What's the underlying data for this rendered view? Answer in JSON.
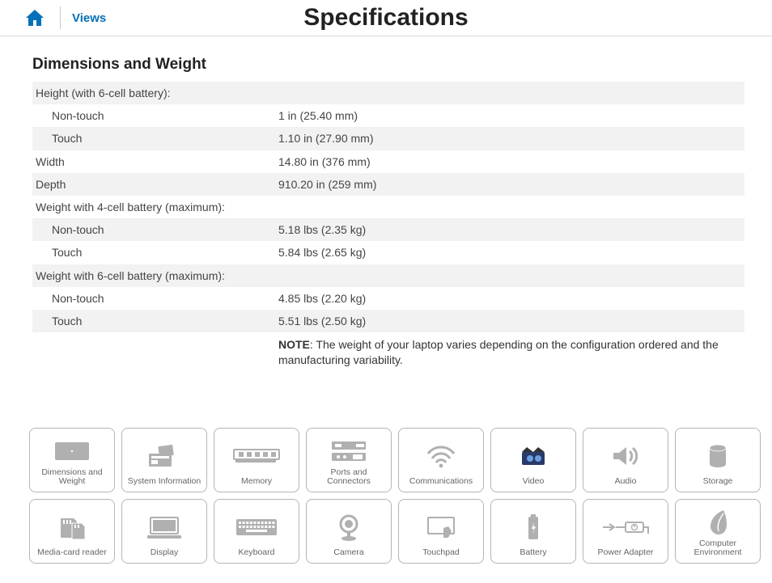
{
  "header": {
    "views_label": "Views",
    "page_title": "Specifications"
  },
  "section": {
    "title": "Dimensions and Weight",
    "rows": [
      {
        "label": "Height (with 6-cell battery):",
        "value": "",
        "sub": false,
        "shade": true
      },
      {
        "label": "Non-touch",
        "value": "1 in (25.40 mm)",
        "sub": true,
        "shade": false
      },
      {
        "label": "Touch",
        "value": "1.10 in (27.90 mm)",
        "sub": true,
        "shade": true
      },
      {
        "label": "Width",
        "value": "14.80 in (376 mm)",
        "sub": false,
        "shade": false
      },
      {
        "label": "Depth",
        "value": "910.20 in (259 mm)",
        "sub": false,
        "shade": true
      },
      {
        "label": "Weight with 4-cell battery (maximum):",
        "value": "",
        "sub": false,
        "shade": false
      },
      {
        "label": "Non-touch",
        "value": "5.18 lbs (2.35 kg)",
        "sub": true,
        "shade": true
      },
      {
        "label": "Touch",
        "value": "5.84 lbs (2.65 kg)",
        "sub": true,
        "shade": false
      },
      {
        "label": "Weight with 6-cell battery (maximum):",
        "value": "",
        "sub": false,
        "shade": true
      },
      {
        "label": "Non-touch",
        "value": "4.85 lbs (2.20 kg)",
        "sub": true,
        "shade": false
      },
      {
        "label": "Touch",
        "value": "5.51 lbs (2.50 kg)",
        "sub": true,
        "shade": true
      }
    ],
    "note_prefix": "NOTE",
    "note_text": ": The weight of your laptop varies depending on the configuration ordered and the manufacturing variability."
  },
  "nav": [
    {
      "name": "dimensions-and-weight",
      "label": "Dimensions and Weight",
      "icon": "dimensions"
    },
    {
      "name": "system-information",
      "label": "System Information",
      "icon": "sysinfo"
    },
    {
      "name": "memory",
      "label": "Memory",
      "icon": "memory"
    },
    {
      "name": "ports-and-connectors",
      "label": "Ports and Connectors",
      "icon": "ports"
    },
    {
      "name": "communications",
      "label": "Communications",
      "icon": "wifi"
    },
    {
      "name": "video",
      "label": "Video",
      "icon": "video"
    },
    {
      "name": "audio",
      "label": "Audio",
      "icon": "audio"
    },
    {
      "name": "storage",
      "label": "Storage",
      "icon": "storage"
    },
    {
      "name": "media-card-reader",
      "label": "Media-card reader",
      "icon": "sdcard"
    },
    {
      "name": "display",
      "label": "Display",
      "icon": "display"
    },
    {
      "name": "keyboard",
      "label": "Keyboard",
      "icon": "keyboard"
    },
    {
      "name": "camera",
      "label": "Camera",
      "icon": "camera"
    },
    {
      "name": "touchpad",
      "label": "Touchpad",
      "icon": "touchpad"
    },
    {
      "name": "battery",
      "label": "Battery",
      "icon": "battery"
    },
    {
      "name": "power-adapter",
      "label": "Power Adapter",
      "icon": "power"
    },
    {
      "name": "computer-environment",
      "label": "Computer Environment",
      "icon": "environment"
    }
  ]
}
